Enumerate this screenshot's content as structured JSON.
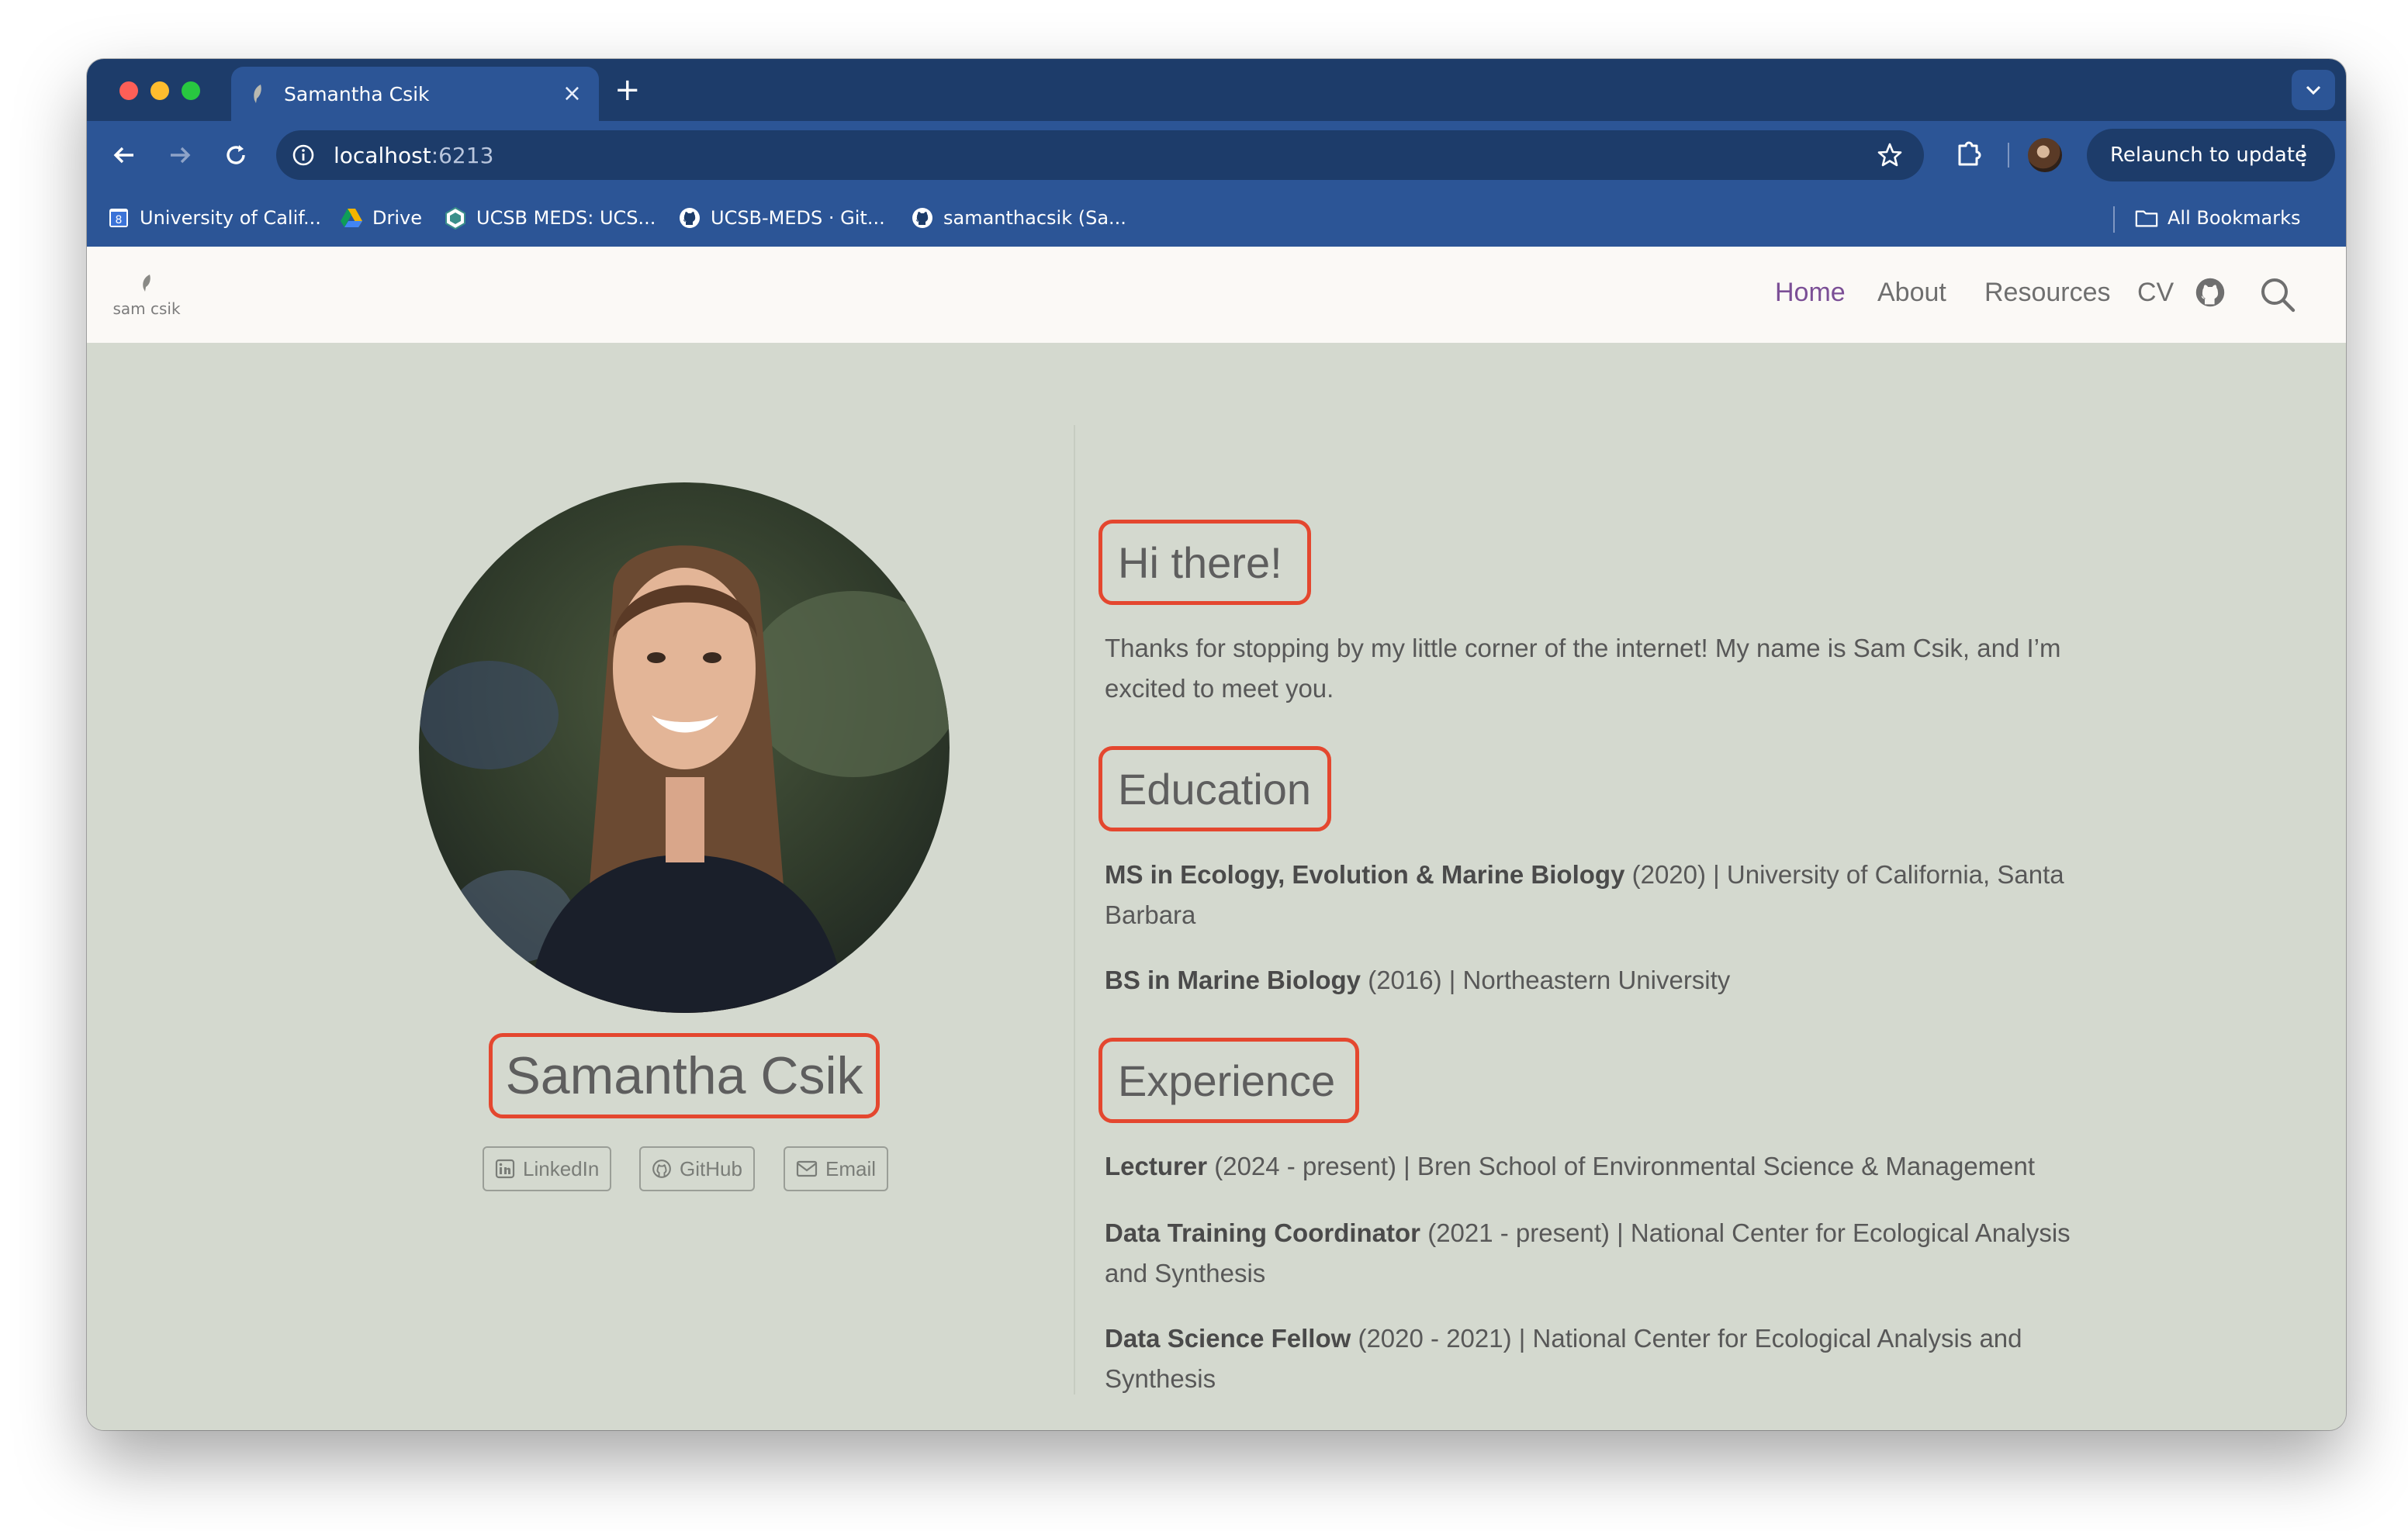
{
  "browser": {
    "tab_title": "Samantha Csik",
    "tab_close": "×",
    "new_tab": "+",
    "url_host": "localhost",
    "url_port": ":6213",
    "relaunch_label": "Relaunch to update",
    "relaunch_menu": "⋮"
  },
  "bookmarks": {
    "items": [
      {
        "label": "University of Calif...",
        "icon": "ucsb-calendar-icon"
      },
      {
        "label": "Drive",
        "icon": "google-drive-icon"
      },
      {
        "label": "UCSB MEDS: UCS...",
        "icon": "meds-hexagon-icon"
      },
      {
        "label": "UCSB-MEDS · Git...",
        "icon": "github-icon"
      },
      {
        "label": "samanthacsik (Sa...",
        "icon": "github-icon"
      }
    ],
    "all_bookmarks": "All Bookmarks"
  },
  "site": {
    "logo_text": "sam csik",
    "nav": {
      "home": "Home",
      "about": "About",
      "resources": "Resources",
      "cv": "CV"
    },
    "name": "Samantha Csik",
    "social": {
      "linkedin": "LinkedIn",
      "github": "GitHub",
      "email": "Email"
    },
    "greeting": {
      "heading": "Hi there!",
      "text": "Thanks for stopping by my little corner of the internet! My name is Sam Csik, and I’m excited to meet you."
    },
    "education": {
      "heading": "Education",
      "items": [
        {
          "degree": "MS in Ecology, Evolution & Marine Biology",
          "detail": " (2020) | University of California, Santa Barbara"
        },
        {
          "degree": "BS in Marine Biology",
          "detail": " (2016) | Northeastern University"
        }
      ]
    },
    "experience": {
      "heading": "Experience",
      "items": [
        {
          "role": "Lecturer",
          "detail": " (2024 - present) | Bren School of Environmental Science & Management"
        },
        {
          "role": "Data Training Coordinator",
          "detail": " (2021 - present) | National Center for Ecological Analysis and Synthesis"
        },
        {
          "role": "Data Science Fellow",
          "detail": " (2020 - 2021) | National Center for Ecological Analysis and Synthesis"
        }
      ]
    }
  },
  "colors": {
    "tab_strip": "#1d3c6a",
    "toolbar": "#2c5596",
    "page_bg": "#d4d9cf",
    "nav_bg": "#fbf9f6",
    "nav_active": "#7b4f96",
    "highlight": "#e4472f"
  }
}
